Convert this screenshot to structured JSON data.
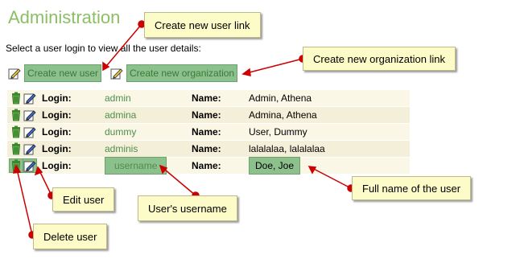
{
  "page": {
    "title": "Administration",
    "instructions": "Select a user login to view all the user details:"
  },
  "actions": {
    "create_user": "Create new user",
    "create_organization": "Create new organization"
  },
  "table": {
    "login_label": "Login:",
    "name_label": "Name:",
    "rows": [
      {
        "login": "admin",
        "name": "Admin, Athena"
      },
      {
        "login": "admina",
        "name": "Admina, Athena"
      },
      {
        "login": "dummy",
        "name": "User, Dummy"
      },
      {
        "login": "adminis",
        "name": "lalalalaa, lalalalaa"
      },
      {
        "login": "username",
        "name": "Doe, Joe"
      }
    ]
  },
  "callouts": {
    "create_user_link": "Create new user link",
    "create_org_link": "Create new organization link",
    "edit_user": "Edit user",
    "users_username": "User's username",
    "full_name": "Full name of the user",
    "delete_user": "Delete user"
  },
  "colors": {
    "title": "#8cbf64",
    "highlight": "#8cc08c",
    "callout_bg": "#fdfbc8",
    "arrow": "#cc0000"
  },
  "icons": {
    "trash": "trash-icon",
    "edit": "edit-icon",
    "create": "create-icon"
  }
}
